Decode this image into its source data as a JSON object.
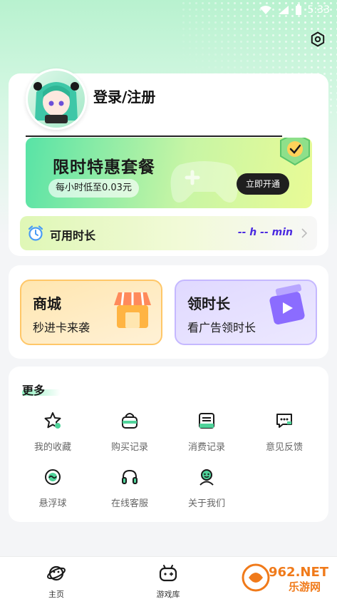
{
  "status_bar": {
    "time": "5:33"
  },
  "profile": {
    "login_label": "登录/注册"
  },
  "promo": {
    "title": "限时特惠套餐",
    "price": "每小时低至0.03元",
    "button": "立即开通"
  },
  "available_time": {
    "label": "可用时长",
    "value": "-- h -- min"
  },
  "features": {
    "shop": {
      "title": "商城",
      "subtitle": "秒进卡来袭"
    },
    "earn_time": {
      "title": "领时长",
      "subtitle": "看广告领时长"
    }
  },
  "more": {
    "title": "更多",
    "items": [
      {
        "label": "我的收藏",
        "icon": "star-icon"
      },
      {
        "label": "购买记录",
        "icon": "bag-icon"
      },
      {
        "label": "消费记录",
        "icon": "receipt-icon"
      },
      {
        "label": "意见反馈",
        "icon": "chat-icon"
      },
      {
        "label": "悬浮球",
        "icon": "float-ball-icon"
      },
      {
        "label": "在线客服",
        "icon": "headset-icon"
      },
      {
        "label": "关于我们",
        "icon": "smile-icon"
      }
    ]
  },
  "bottom_nav": {
    "items": [
      {
        "label": "主页",
        "icon": "planet-icon"
      },
      {
        "label": "游戏库",
        "icon": "gamepad-icon"
      }
    ]
  },
  "watermark": {
    "text": "962.NET",
    "subtext": "乐游网"
  },
  "colors": {
    "accent_green": "#58e3a6",
    "time_value": "#4b2be0",
    "shop_border": "#ffc768",
    "earn_border": "#c5b8ff"
  }
}
